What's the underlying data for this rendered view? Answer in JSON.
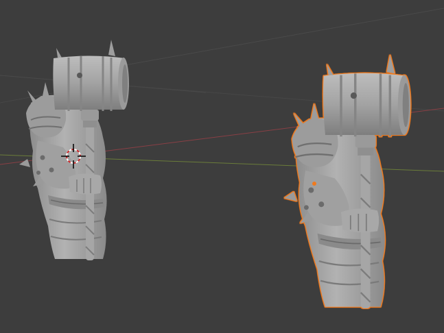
{
  "viewport": {
    "type": "3d-viewport",
    "background_color": "#3d3d3d",
    "grid_line_color": "#4a4a4a",
    "x_axis_color": "#8a3f45",
    "y_axis_color": "#6b7d3a",
    "selection_outline_color": "#f07a1e",
    "origin_dot_color": "#f07a1e",
    "cursor_colors": [
      "#d0282a",
      "#ffffff",
      "#000000"
    ]
  },
  "objects": [
    {
      "name": "armored-figure-with-hammer",
      "state": "unselected",
      "mesh_color": "#a8a8a8"
    },
    {
      "name": "armored-figure-with-hammer-copy",
      "state": "selected",
      "mesh_color": "#a9a9a9"
    }
  ],
  "icons": {
    "cursor": "3d-cursor-icon",
    "origin": "object-origin-dot"
  }
}
